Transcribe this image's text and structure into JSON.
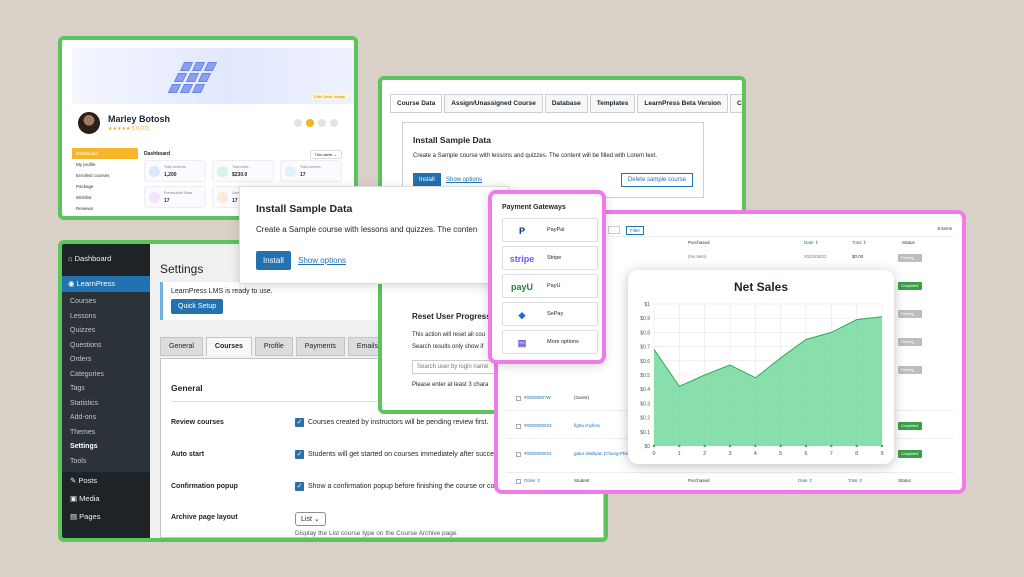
{
  "profile": {
    "hero_tag": "Edit Cover Image",
    "name": "Marley Botosh",
    "rating": "★★★★★ 5.0 (22)",
    "sidebar": [
      "Dashboard",
      "My profile",
      "Enrolled courses",
      "Package",
      "Wishlist",
      "Reviews"
    ],
    "dash_title": "Dashboard",
    "this_week": "This week ⌄",
    "stats": [
      {
        "label": "Total students",
        "value": "1,200",
        "color": "#dbe7ff"
      },
      {
        "label": "Total sales",
        "value": "$230.0",
        "color": "#d7f5e4"
      },
      {
        "label": "Total courses",
        "value": "17",
        "color": "#dff3ff"
      },
      {
        "label": "Prerequisite Sales",
        "value": "17",
        "color": "#f3e2ff"
      },
      {
        "label": "Sample",
        "value": "17",
        "color": "#ffe8d6"
      }
    ]
  },
  "wp": {
    "menu_top": [
      "Dashboard"
    ],
    "learnpress": "LearnPress",
    "submenu": [
      "Courses",
      "Lessons",
      "Quizzes",
      "Questions",
      "Orders",
      "Categories",
      "Tags",
      "Statistics",
      "Add-ons",
      "Themes",
      "Settings",
      "Tools"
    ],
    "menu_bottom": [
      "Posts",
      "Media",
      "Pages"
    ],
    "title": "Settings",
    "notice": "LearnPress LMS is ready to use.",
    "quick_setup": "Quick Setup",
    "tabs": [
      "General",
      "Courses",
      "Profile",
      "Payments",
      "Emails",
      "P"
    ],
    "section": "General",
    "rows": [
      {
        "key": "Review courses",
        "value": "Courses created by instructors will be pending review first."
      },
      {
        "key": "Auto start",
        "value": "Students will get started on courses immediately after succe"
      },
      {
        "key": "Confirmation popup",
        "value": "Show a confirmation popup before finishing the course or co"
      }
    ],
    "archive_label": "Archive page layout",
    "archive_value": "List ⌄",
    "archive_hint": "Display the List course type on the Course Archive page."
  },
  "course": {
    "tabs": [
      "Course Data",
      "Assign/Unassigned Course",
      "Database",
      "Templates",
      "LearnPress Beta Version",
      "C"
    ],
    "install_title": "Install Sample Data",
    "install_desc": "Create a Sample course with lessons and quizzes. The content will be filled with Lorem text.",
    "install_btn": "Install",
    "show_options": "Show options",
    "delete_btn": "Delete sample course",
    "reset_title": "Reset User Progress",
    "reset_desc": "This action will reset all cou",
    "reset_desc2": "Search results only show if",
    "reset_placeholder": "Search user by login name",
    "reset_note": "Please enter at least 3 chara"
  },
  "install_popup": {
    "title": "Install Sample Data",
    "desc": "Create a Sample course with lessons and quizzes. The conten",
    "install": "Install",
    "show_options": "Show options"
  },
  "payment": {
    "title": "Payment Gateways",
    "items": [
      {
        "logo": "P",
        "name": "PayPal",
        "color": "#003087"
      },
      {
        "logo": "stripe",
        "name": "Stripe",
        "color": "#635bff"
      },
      {
        "logo": "payU",
        "name": "PayU",
        "color": "#1c8a3a"
      },
      {
        "logo": "◆",
        "name": "SePay",
        "color": "#1f6fd6"
      },
      {
        "logo": "▤",
        "name": "More options",
        "color": "#6b4fcf"
      }
    ]
  },
  "orders": {
    "filter": "Filter",
    "count": "8 items",
    "header": [
      "Purchased",
      "Date ⇕",
      "Total ⇕",
      "Status"
    ],
    "top_row": [
      "(No item)",
      "2023/03/22",
      "$0.00"
    ],
    "footer": [
      "Order ⇕",
      "Student",
      "Purchased",
      "Date ⇕",
      "Total ⇕",
      "Status"
    ],
    "rows": [
      {
        "id": "#0000000?W",
        "student": "(Guest)",
        "status": "Pending"
      },
      {
        "id": "#0000000023",
        "student": "figha chyfera",
        "status": "Completed"
      },
      {
        "id": "#0000000024",
        "student": "gatur elabtyan (Chung-Phila)",
        "status": "Completed"
      }
    ],
    "status_list": [
      "Pending",
      "Completed",
      "Pending",
      "Pending",
      "Pending",
      "Completed",
      "Completed"
    ]
  },
  "chart_data": {
    "type": "area",
    "title": "Net Sales",
    "x": [
      0,
      1,
      2,
      3,
      4,
      5,
      6,
      7,
      8,
      9
    ],
    "values": [
      0.68,
      0.42,
      0.5,
      0.57,
      0.48,
      0.62,
      0.75,
      0.8,
      0.89,
      0.91
    ],
    "ylim": [
      0,
      1
    ],
    "yticks": [
      "$0",
      "$0.1",
      "$0.2",
      "$0.3",
      "$0.4",
      "$0.5",
      "$0.6",
      "$0.7",
      "$0.8",
      "$0.9",
      "$1"
    ],
    "color": "#4cc97f",
    "grid": true
  },
  "colors": {
    "green_frame": "#5cc45c",
    "pink_frame": "#f07ae8",
    "wp_blue": "#2271b1"
  }
}
